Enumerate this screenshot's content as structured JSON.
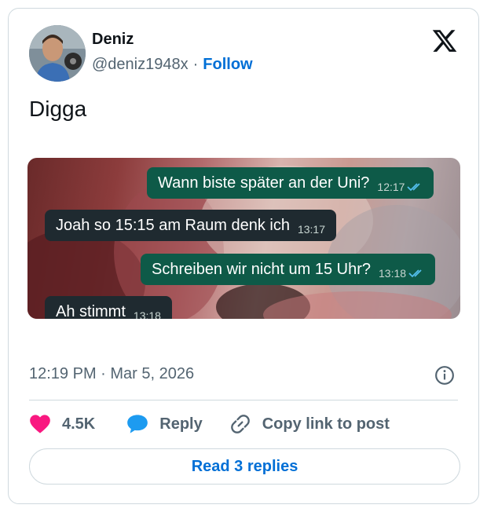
{
  "author": {
    "name": "Deniz",
    "handle": "@deniz1948x",
    "separator": "·",
    "follow_label": "Follow"
  },
  "tweet": {
    "text": "Digga",
    "timestamp": "12:19 PM · Mar 5, 2026"
  },
  "media": {
    "messages": [
      {
        "direction": "out",
        "text": "Wann biste später an der Uni?",
        "time": "12:17",
        "read": true
      },
      {
        "direction": "in",
        "text": "Joah so 15:15 am Raum denk ich",
        "time": "13:17",
        "read": false
      },
      {
        "direction": "out",
        "text": "Schreiben wir nicht um 15 Uhr?",
        "time": "13:18",
        "read": true
      },
      {
        "direction": "in",
        "text": "Ah stimmt",
        "time": "13:18",
        "read": false
      }
    ]
  },
  "actions": {
    "likes_count": "4.5K",
    "reply_label": "Reply",
    "copy_label": "Copy link to post"
  },
  "footer": {
    "read_replies_label": "Read 3 replies"
  },
  "icons": {
    "logo": "x-logo-icon",
    "info": "info-icon",
    "like": "heart-icon",
    "reply": "speech-bubble-icon",
    "copy": "link-icon"
  },
  "colors": {
    "accent": "#006fd6",
    "like": "#f91880",
    "reply": "#1d9bf0",
    "bubble_out": "#0e5a48",
    "bubble_in": "#1f2a30"
  }
}
